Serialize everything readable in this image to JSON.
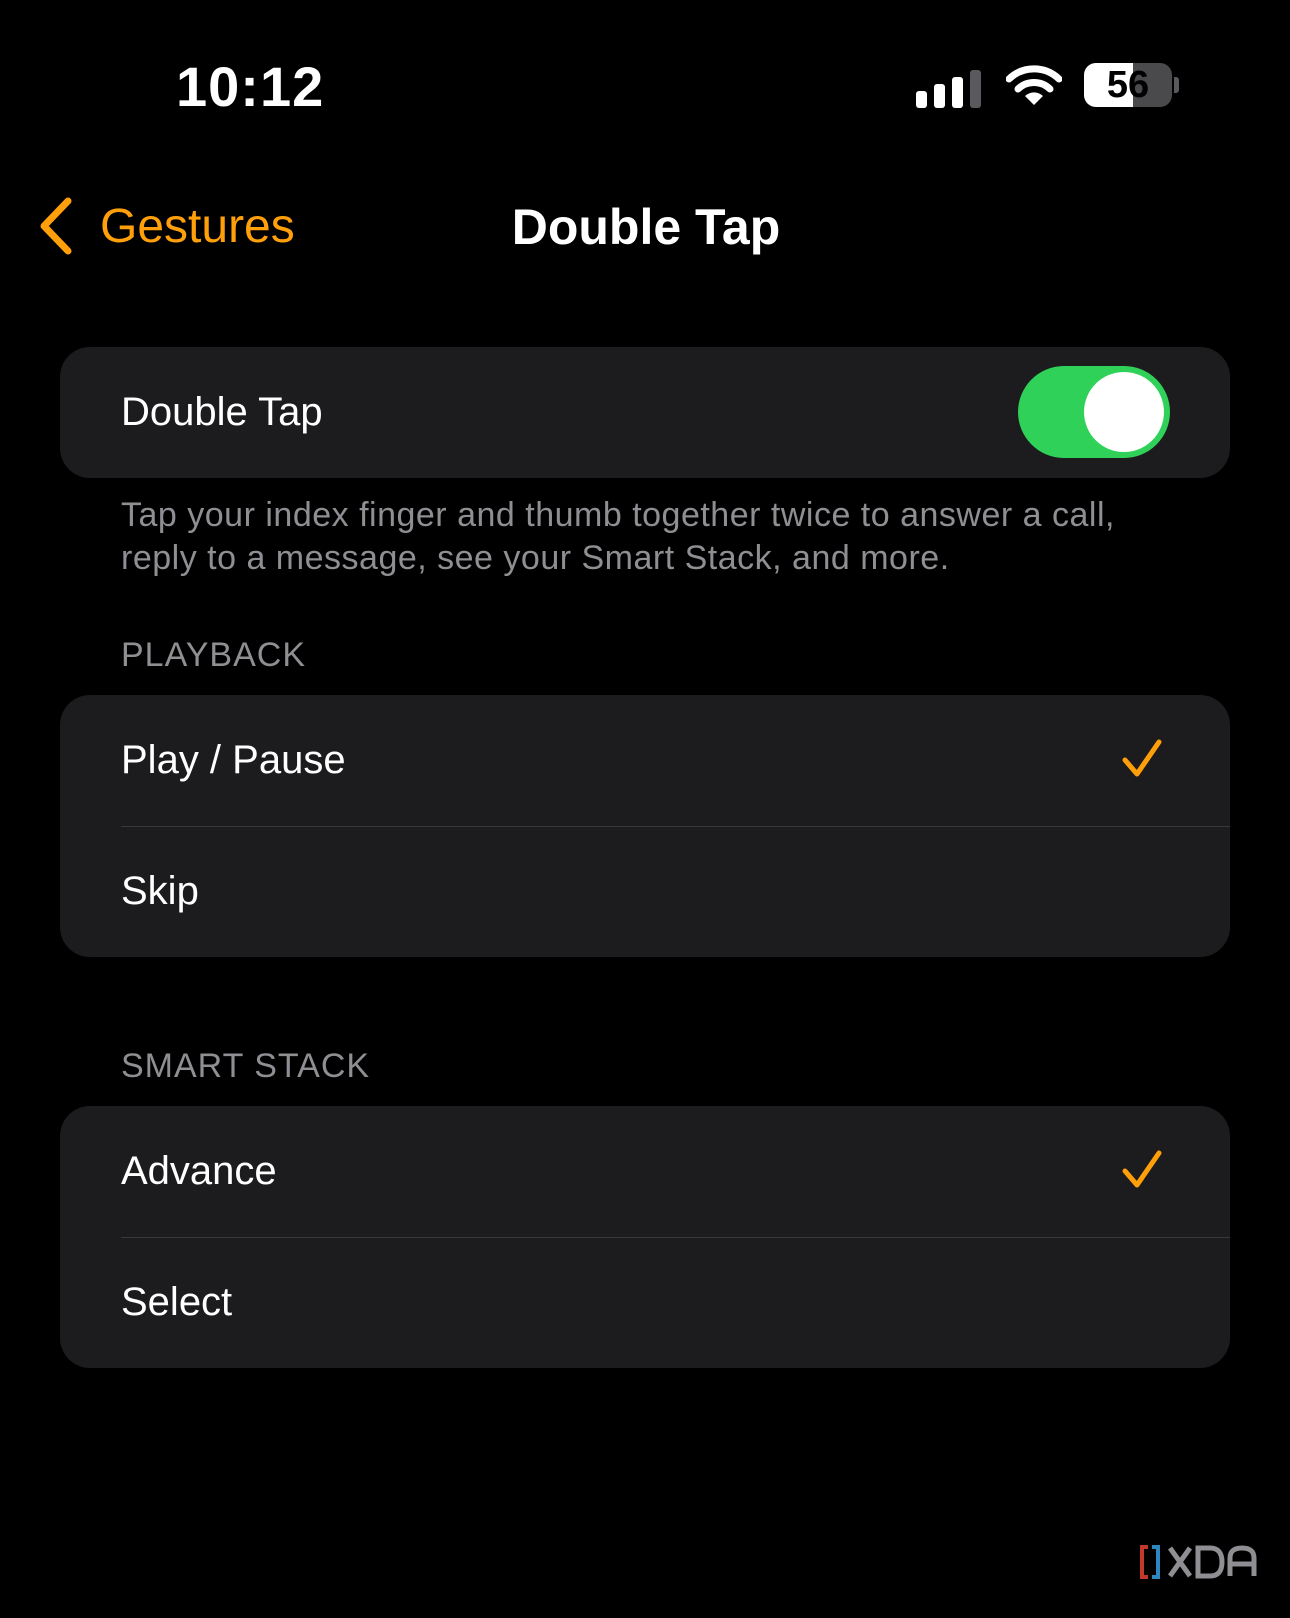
{
  "status_bar": {
    "time": "10:12",
    "battery_percent": "56",
    "battery_level": 0.56,
    "signal_bars_active": 3,
    "signal_bars_total": 4
  },
  "nav": {
    "back_label": "Gestures",
    "title": "Double Tap"
  },
  "double_tap": {
    "label": "Double Tap",
    "enabled": true,
    "description": "Tap your index finger and thumb together twice to answer a call, reply to a message, see your Smart Stack, and more."
  },
  "playback": {
    "header": "PLAYBACK",
    "options": [
      {
        "label": "Play / Pause",
        "selected": true
      },
      {
        "label": "Skip",
        "selected": false
      }
    ]
  },
  "smart_stack": {
    "header": "SMART STACK",
    "options": [
      {
        "label": "Advance",
        "selected": true
      },
      {
        "label": "Select",
        "selected": false
      }
    ]
  },
  "colors": {
    "accent": "#ff9f0a",
    "toggle_on": "#30d158",
    "background": "#000000",
    "group_background": "#1c1c1e",
    "secondary_text": "#8e8e93"
  },
  "watermark": "XDA"
}
